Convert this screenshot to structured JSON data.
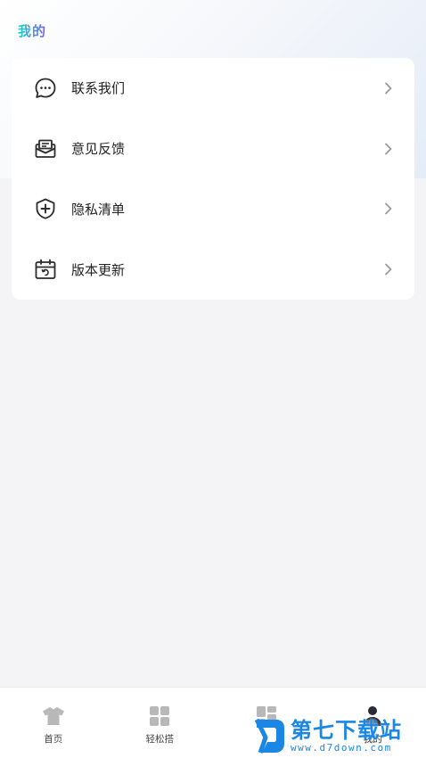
{
  "header": {
    "title": "我的"
  },
  "menu": {
    "items": [
      {
        "label": "联系我们",
        "icon": "chat-bubble-icon"
      },
      {
        "label": "意见反馈",
        "icon": "feedback-mail-icon"
      },
      {
        "label": "隐私清单",
        "icon": "shield-plus-icon"
      },
      {
        "label": "版本更新",
        "icon": "calendar-update-icon"
      }
    ]
  },
  "bottom_nav": {
    "items": [
      {
        "label": "首页",
        "icon": "tshirt-icon"
      },
      {
        "label": "轻松搭",
        "icon": "grid-icon"
      },
      {
        "label": "",
        "icon": "layout-icon"
      },
      {
        "label": "我的",
        "icon": "person-icon",
        "active": true
      }
    ]
  },
  "watermark": {
    "name": "第七下载站",
    "url": "www.d7down.com"
  },
  "colors": {
    "background": "#f4f4f6",
    "card": "#ffffff",
    "title_gradient_start": "#17d4c8",
    "title_gradient_end": "#7b5cf0",
    "nav_icon": "#b8b8b8",
    "watermark": "#1a86e6"
  }
}
